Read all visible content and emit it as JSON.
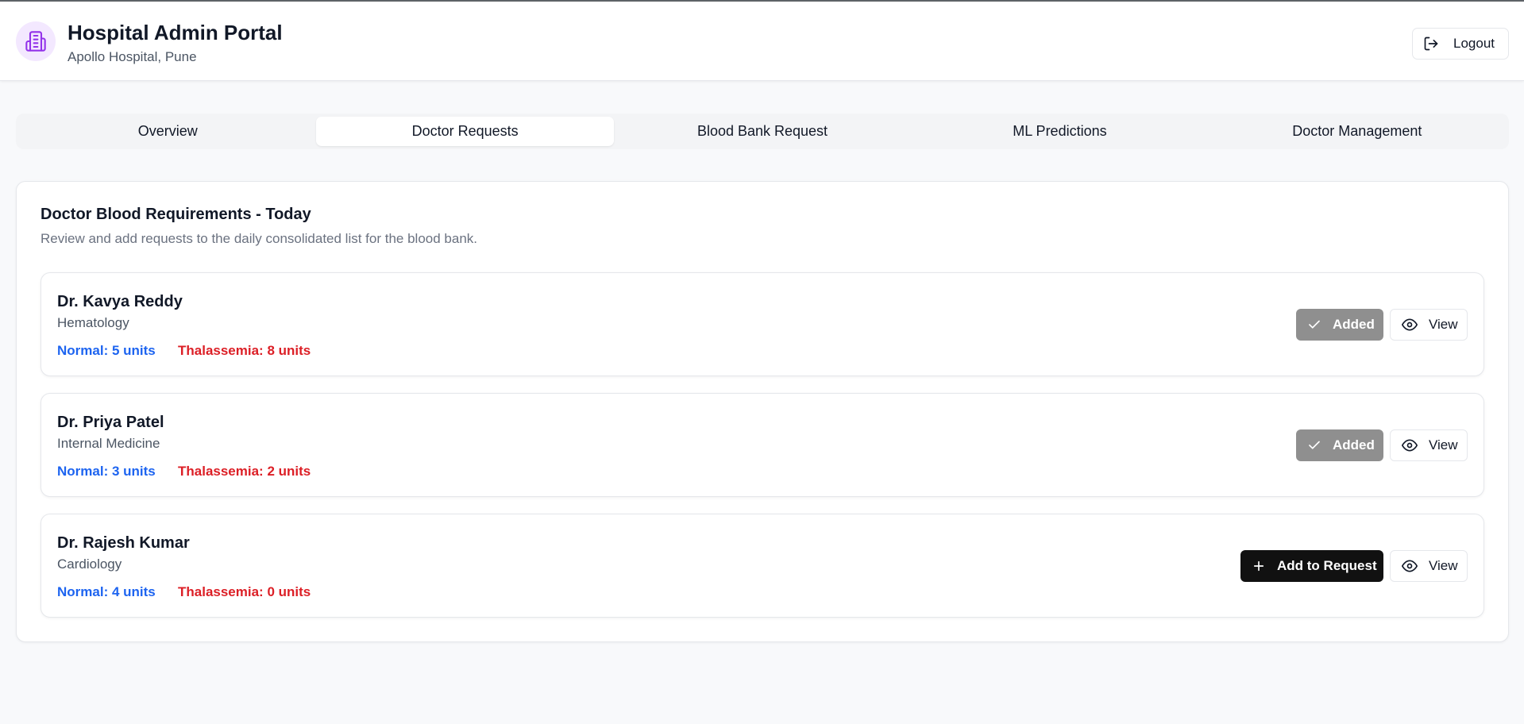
{
  "header": {
    "title": "Hospital Admin Portal",
    "subtitle": "Apollo Hospital, Pune",
    "logout_label": "Logout",
    "logo_icon": "hospital-building-icon",
    "accent_color": "#9333ea"
  },
  "tabs": [
    {
      "label": "Overview",
      "active": false
    },
    {
      "label": "Doctor Requests",
      "active": true
    },
    {
      "label": "Blood Bank Request",
      "active": false
    },
    {
      "label": "ML Predictions",
      "active": false
    },
    {
      "label": "Doctor Management",
      "active": false
    }
  ],
  "main": {
    "title": "Doctor Blood Requirements - Today",
    "description": "Review and add requests to the daily consolidated list for the blood bank.",
    "requests": [
      {
        "doctor": "Dr. Kavya Reddy",
        "department": "Hematology",
        "normal": "Normal: 5 units",
        "thalassemia": "Thalassemia: 8 units",
        "status_label": "Added",
        "added": true,
        "view_label": "View"
      },
      {
        "doctor": "Dr. Priya Patel",
        "department": "Internal Medicine",
        "normal": "Normal: 3 units",
        "thalassemia": "Thalassemia: 2 units",
        "status_label": "Added",
        "added": true,
        "view_label": "View"
      },
      {
        "doctor": "Dr. Rajesh Kumar",
        "department": "Cardiology",
        "normal": "Normal: 4 units",
        "thalassemia": "Thalassemia: 0 units",
        "status_label": "Add to Request",
        "added": false,
        "view_label": "View"
      }
    ]
  },
  "colors": {
    "normal": "#1d64f0",
    "thalassemia": "#dc1f26",
    "added_button": "#8f8f8f",
    "add_button": "#111111"
  }
}
